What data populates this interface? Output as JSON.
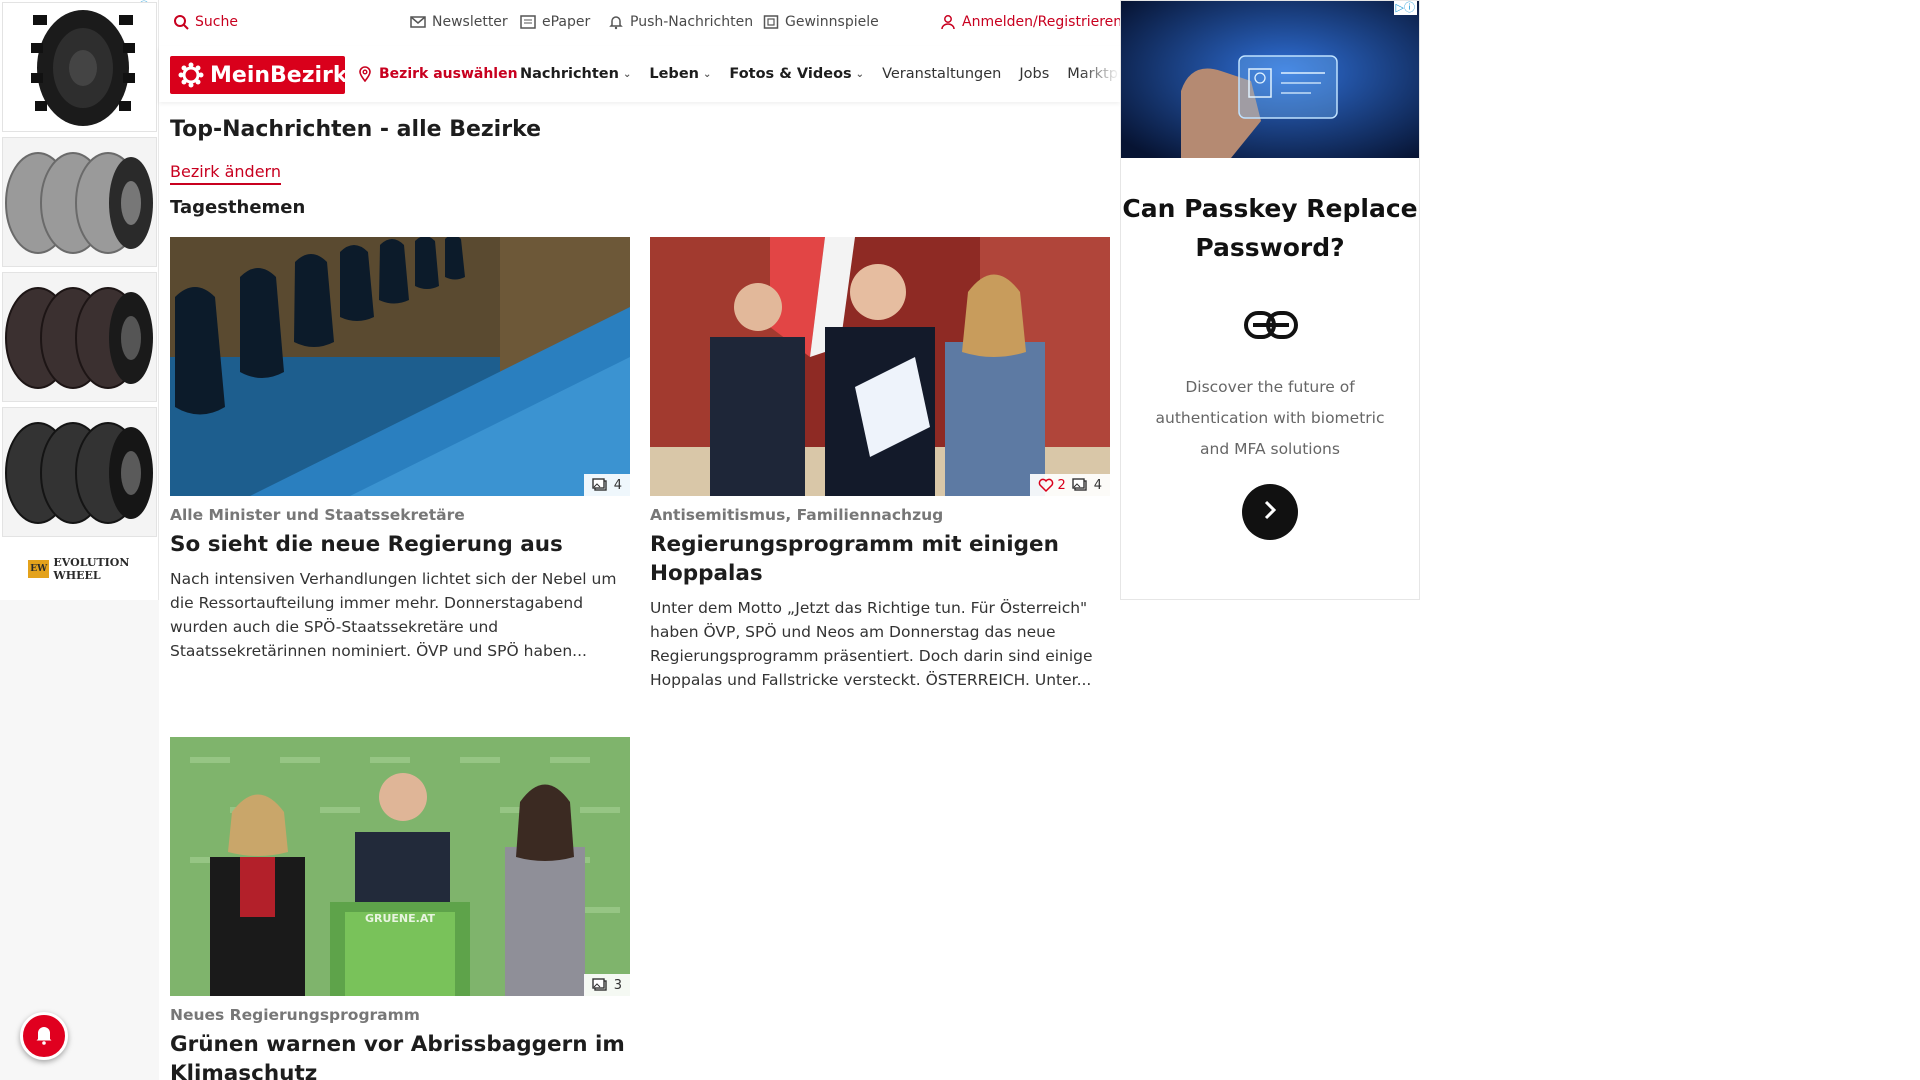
{
  "topbar": {
    "search": "Suche",
    "newsletter": "Newsletter",
    "epaper": "ePaper",
    "push": "Push-Nachrichten",
    "gewinnspiele": "Gewinnspiele",
    "login": "Anmelden/Registrieren"
  },
  "nav": {
    "logo": "MeinBezirk",
    "bezirk": "Bezirk auswählen",
    "items": [
      {
        "label": "Nachrichten",
        "dropdown": true
      },
      {
        "label": "Leben",
        "dropdown": true
      },
      {
        "label": "Fotos & Videos",
        "dropdown": true
      },
      {
        "label": "Veranstaltungen",
        "dropdown": false
      },
      {
        "label": "Jobs",
        "dropdown": false
      },
      {
        "label": "Marktplatz",
        "dropdown": false
      }
    ]
  },
  "page": {
    "title": "Top-Nachrichten - alle Bezirke",
    "change_link": "Bezirk ändern",
    "section": "Tagesthemen"
  },
  "articles": [
    {
      "kicker": "Alle Minister und Staatssekretäre",
      "headline": "So sieht die neue Regierung aus",
      "teaser": "Nach intensiven Verhandlungen lichtet sich der Nebel um die Ressortaufteilung immer mehr. Donnerstagabend wurden auch die SPÖ-Staatssekretäre und Staatssekretärinnen nominiert. ÖVP und SPÖ haben...",
      "likes": "",
      "images": "4"
    },
    {
      "kicker": "Antisemitismus, Familiennachzug",
      "headline": "Regierungsprogramm mit einigen Hoppalas",
      "teaser": "Unter dem Motto „Jetzt das Richtige tun. Für Österreich\" haben ÖVP, SPÖ und Neos am Donnerstag das neue Regierungsprogramm präsentiert. Doch darin sind einige Hoppalas und Fallstricke versteckt. ÖSTERREICH. Unter...",
      "likes": "2",
      "images": "4"
    },
    {
      "kicker": "Neues Regierungsprogramm",
      "headline": "Grünen warnen vor Abrissbaggern im Klimaschutz",
      "teaser": "",
      "likes": "",
      "images": "3"
    }
  ],
  "photo_text": {
    "podium": "GRUENE.AT"
  },
  "left_ad": {
    "brand": "EVOLUTION WHEEL",
    "brand_mark": "EW",
    "adchoice": "▷ⓘ"
  },
  "right_ad": {
    "question": "Can Passkey Replace Password?",
    "description": "Discover the future of authentication with biometric and MFA solutions",
    "adchoice": "▷ⓘ"
  },
  "colors": {
    "brand_red": "#d9001b",
    "link_red": "#c8001f",
    "kicker_gray": "#777777"
  }
}
